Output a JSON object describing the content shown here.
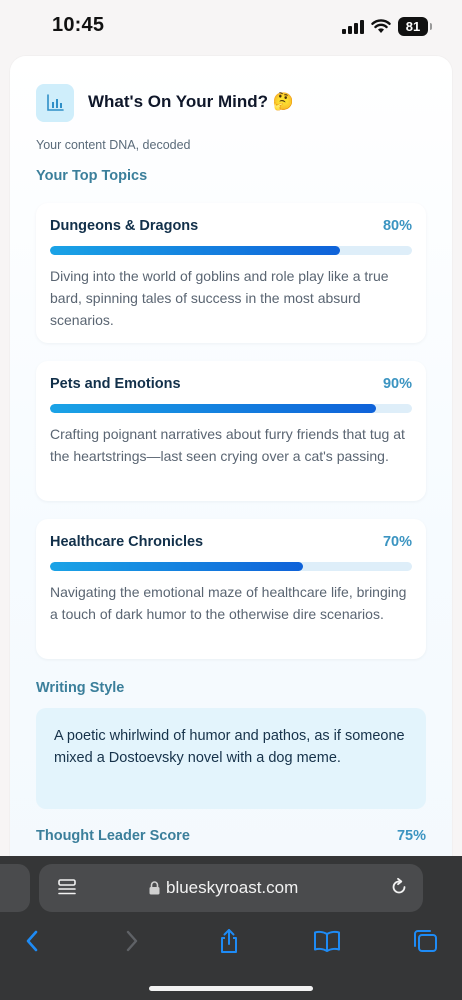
{
  "status": {
    "time": "10:45",
    "battery": "81"
  },
  "card": {
    "title": "What's On Your Mind? 🤔",
    "subtitle": "Your content DNA, decoded",
    "topics_heading": "Your Top Topics",
    "topics": [
      {
        "name": "Dungeons & Dragons",
        "percent_label": "80%",
        "percent": 80,
        "description": "Diving into the world of goblins and role play like a true bard, spinning tales of success in the most absurd scenarios."
      },
      {
        "name": "Pets and Emotions",
        "percent_label": "90%",
        "percent": 90,
        "description": "Crafting poignant narratives about furry friends that tug at the heartstrings—last seen crying over a cat's passing."
      },
      {
        "name": "Healthcare Chronicles",
        "percent_label": "70%",
        "percent": 70,
        "description": "Navigating the emotional maze of healthcare life, bringing a touch of dark humor to the otherwise dire scenarios."
      }
    ],
    "writing_style_heading": "Writing Style",
    "writing_style_text": "A poetic whirlwind of humor and pathos, as if someone mixed a Dostoevsky novel with a dog meme.",
    "thought_leader_label": "Thought Leader Score",
    "thought_leader_value": "75%"
  },
  "browser": {
    "url": "blueskyroast.com"
  },
  "colors": {
    "accent": "#3b94c1",
    "bar_start": "#1aa3e6",
    "bar_end": "#0f62d9",
    "toolbar": "#353637"
  },
  "icons": {
    "chart": "bar-chart-icon",
    "signal": "cellular-signal-icon",
    "wifi": "wifi-icon",
    "lock": "lock-icon",
    "reload": "reload-icon",
    "tabs": "tab-overview-icon",
    "back": "back-chevron-icon",
    "forward": "forward-chevron-icon",
    "share": "share-icon",
    "bookmarks": "bookmarks-icon",
    "tab_switcher": "tabs-icon"
  }
}
